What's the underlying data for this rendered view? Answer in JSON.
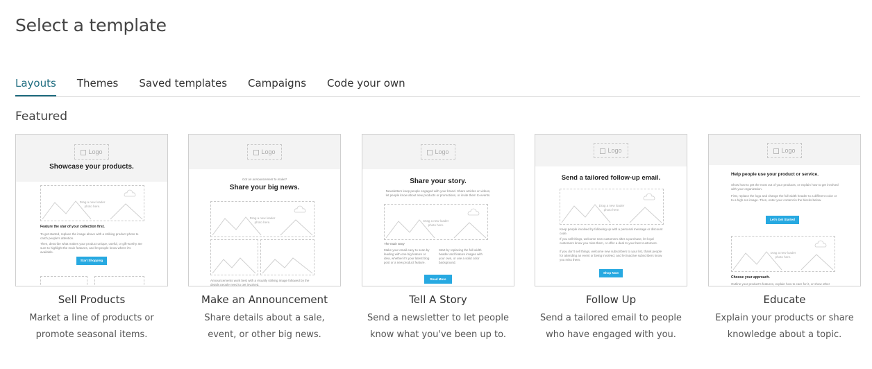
{
  "page": {
    "title": "Select a template"
  },
  "tabs": [
    {
      "label": "Layouts",
      "active": true
    },
    {
      "label": "Themes",
      "active": false
    },
    {
      "label": "Saved templates",
      "active": false
    },
    {
      "label": "Campaigns",
      "active": false
    },
    {
      "label": "Code your own",
      "active": false
    }
  ],
  "section": {
    "title": "Featured"
  },
  "colors": {
    "accent": "#1f6d80",
    "button": "#27a9e1",
    "tab_border": "#d9d9d9"
  },
  "preview": {
    "logo": "Logo",
    "drag": [
      "Drag a new loader",
      "photo here."
    ]
  },
  "cards": [
    {
      "title": "Sell Products",
      "description": "Market a line of products or promote seasonal items.",
      "preview": {
        "heading": "Showcase your products.",
        "subheading": "Feature the star of your collection first.",
        "text1": "To get started, replace the image above with a striking product photo to catch people's attention.",
        "text2": "Then, describe what makes your product unique, useful, or gift-worthy. Be sure to highlight the main features, and let people know where it's available.",
        "button": "Start Shopping"
      }
    },
    {
      "title": "Make an Announcement",
      "description": "Share details about a sale, event, or other big news.",
      "preview": {
        "kicker": "Got an announcement to make?",
        "heading": "Share your big news.",
        "footer": "Announcements work best with a visually striking image followed by the details people need to get involved."
      }
    },
    {
      "title": "Tell A Story",
      "description": "Send a newsletter to let people know what you've been up to.",
      "preview": {
        "heading": "Share your story.",
        "intro": "Newsletters keep people engaged with your brand. Share articles or videos, let people know about new products or promotions, or invite them to events.",
        "story_label": "The main story",
        "col1": "Make your email easy to scan by leading with one big feature or idea, whether it's your latest blog post or a new product feature.",
        "col2": "Start by replacing the full-width header and feature images with your own, or use a solid color background.",
        "button": "Read More"
      }
    },
    {
      "title": "Follow Up",
      "description": "Send a tailored email to people who have engaged with you.",
      "preview": {
        "heading": "Send a tailored follow-up email.",
        "text1": "Keep people involved by following up with a personal message or discount code.",
        "text2": "If you sell things, welcome new customers after a purchase, let loyal customers know you miss them, or offer a deal to your best customers.",
        "text3": "If you don't sell things, welcome new subscribers to your list, thank people for attending an event or being involved, and let inactive subscribers know you miss them.",
        "button": "Shop Now"
      }
    },
    {
      "title": "Educate",
      "description": "Explain your products or share knowledge about a topic.",
      "preview": {
        "heading": "Help people use your product or service.",
        "text1": "Show how to get the most out of your products, or explain how to get involved with your organization.",
        "text2": "First, replace the logo and change the full-width header to a different color or to a high-res image. Then, enter your content in the blocks below.",
        "button": "Let's Get Started",
        "subheading": "Choose your approach.",
        "footer": "Outline your product's features, explain how to care for it, or show other"
      }
    }
  ]
}
